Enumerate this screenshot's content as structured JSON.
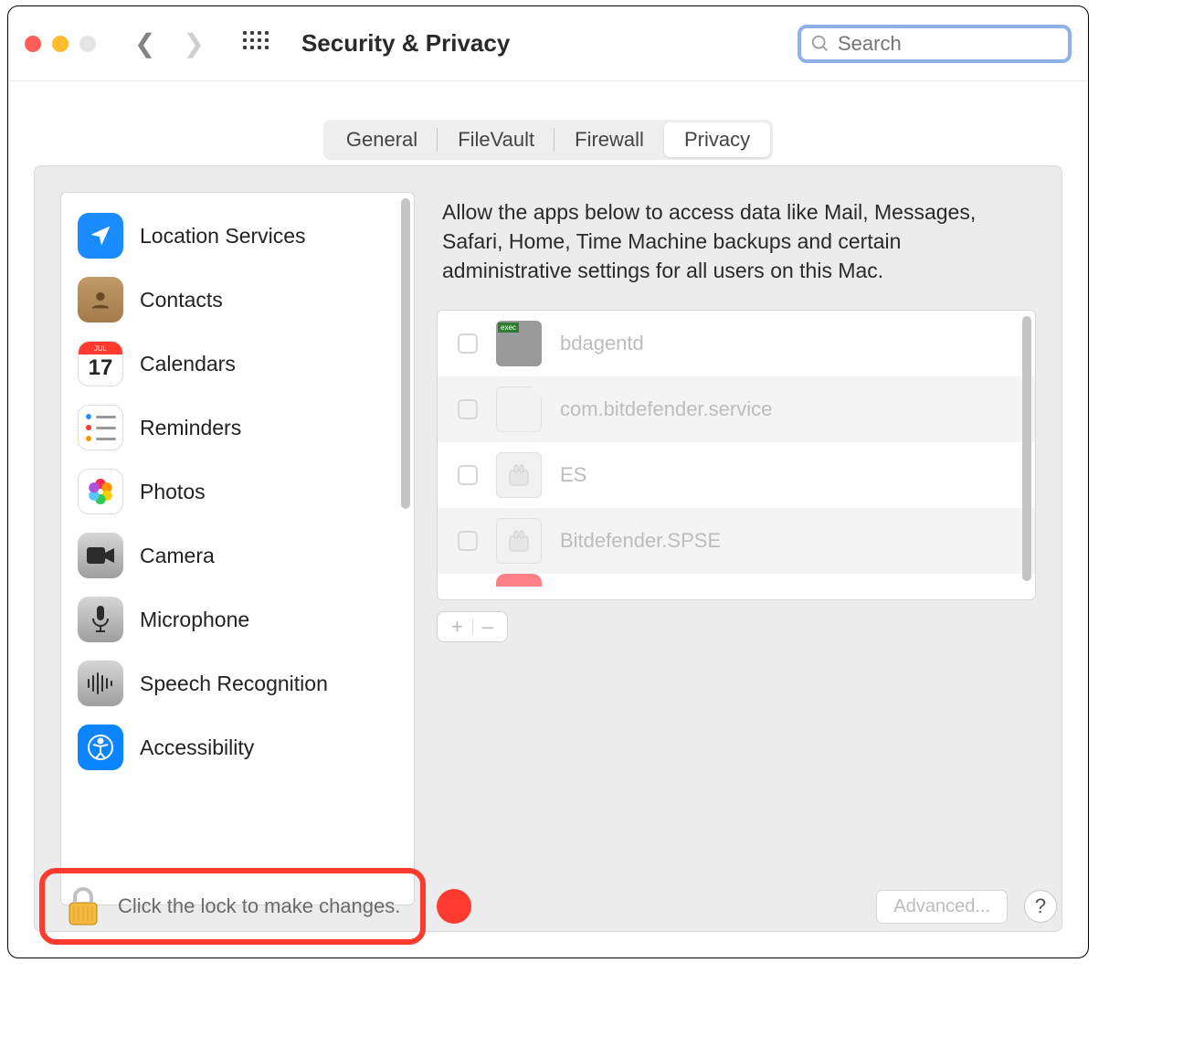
{
  "window": {
    "title": "Security & Privacy"
  },
  "search": {
    "placeholder": "Search"
  },
  "tabs": {
    "general": "General",
    "filevault": "FileVault",
    "firewall": "Firewall",
    "privacy": "Privacy"
  },
  "sidebar": {
    "items": [
      {
        "label": "Location Services"
      },
      {
        "label": "Contacts"
      },
      {
        "label": "Calendars",
        "month": "JUL",
        "day": "17"
      },
      {
        "label": "Reminders"
      },
      {
        "label": "Photos"
      },
      {
        "label": "Camera"
      },
      {
        "label": "Microphone"
      },
      {
        "label": "Speech Recognition"
      },
      {
        "label": "Accessibility"
      }
    ]
  },
  "right": {
    "description": "Allow the apps below to access data like Mail, Messages, Safari, Home, Time Machine backups and certain administrative settings for all users on this Mac.",
    "apps": [
      {
        "name": "bdagentd"
      },
      {
        "name": "com.bitdefender.service"
      },
      {
        "name": "ES"
      },
      {
        "name": "Bitdefender.SPSE"
      }
    ],
    "add": "+",
    "remove": "–"
  },
  "footer": {
    "lock_text": "Click the lock to make changes.",
    "advanced": "Advanced...",
    "help": "?"
  }
}
